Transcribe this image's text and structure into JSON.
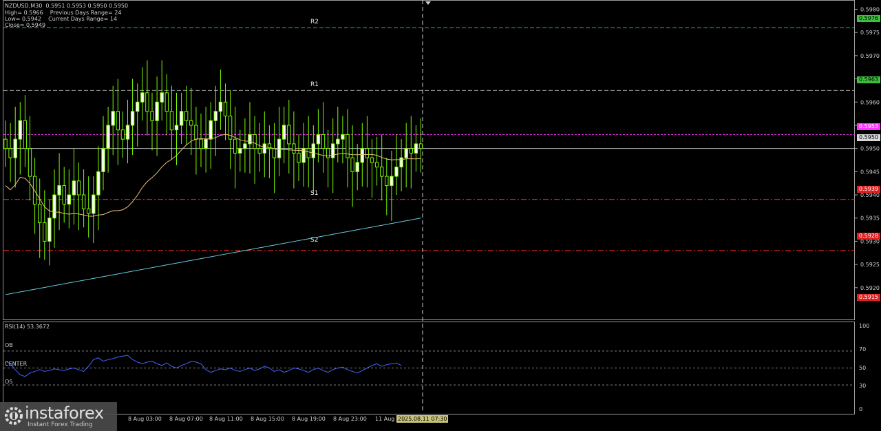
{
  "header": {
    "symbol_line": "NZDUSD,M30  0.5951 0.5953 0.5950 0.5950",
    "line2": "High= 0.5966    Previous Days Range= 24",
    "line3": "Low= 0.5942    Current Days Range= 14",
    "line4": "Close= 0.5949"
  },
  "levels": {
    "r2": "R2",
    "r1": "R1",
    "s1": "S1",
    "s2": "S2"
  },
  "price_tags": {
    "r2": "0.5976",
    "r1": "0.5963",
    "pivot": "0.5953",
    "current": "0.5950",
    "s1": "0.5939",
    "s2": "0.5928",
    "s3": "0.5915"
  },
  "colors": {
    "bull": "#7CFC00",
    "bull_fill": "#ffffff",
    "r_line": "#3fbf3f",
    "s_line": "#ff2a2a",
    "pivot_line": "#ff33ff",
    "ma_fast": "#e8c27a",
    "ma_slow": "#66ccdd",
    "rsi_line": "#4466ff"
  },
  "rsi": {
    "title": "RSI(14) 53.3672",
    "ob": "OB",
    "center": "CENTER",
    "os": "OS",
    "axis": [
      "100",
      "70",
      "50",
      "30",
      "0"
    ]
  },
  "x_labels": [
    "8 Aug 03:00",
    "8 Aug 07:00",
    "8 Aug 11:00",
    "8 Aug 15:00",
    "8 Aug 19:00",
    "8 Aug 23:00",
    "11 Aug",
    "2025.08.11 07:30"
  ],
  "logo": {
    "brand": "instaforex",
    "tagline": "Instant Forex Trading"
  },
  "chart_data": {
    "type": "candlestick",
    "title": "NZDUSD,M30",
    "y_ticks": [
      "0.5980",
      "0.5975",
      "0.5970",
      "0.5965",
      "0.5960",
      "0.5955",
      "0.5950",
      "0.5945",
      "0.5940",
      "0.5935",
      "0.5930",
      "0.5925",
      "0.5920"
    ],
    "ylim": [
      0.5913,
      0.5982
    ],
    "series": [
      {
        "name": "close",
        "values": [
          0.595,
          0.5948,
          0.5952,
          0.5956,
          0.595,
          0.5944,
          0.5938,
          0.5934,
          0.593,
          0.5935,
          0.594,
          0.5942,
          0.5938,
          0.594,
          0.5943,
          0.594,
          0.5937,
          0.5936,
          0.594,
          0.5945,
          0.595,
          0.5955,
          0.5958,
          0.5954,
          0.5952,
          0.5955,
          0.5958,
          0.596,
          0.5962,
          0.5958,
          0.5956,
          0.596,
          0.5962,
          0.5958,
          0.5954,
          0.5955,
          0.5958,
          0.5956,
          0.5955,
          0.5952,
          0.595,
          0.5952,
          0.5956,
          0.5958,
          0.596,
          0.5957,
          0.5952,
          0.5949,
          0.595,
          0.5951,
          0.5953,
          0.595,
          0.5949,
          0.5951,
          0.595,
          0.5948,
          0.5952,
          0.5955,
          0.5951,
          0.5949,
          0.5947,
          0.595,
          0.5948,
          0.5951,
          0.5953,
          0.595,
          0.5948,
          0.5951,
          0.5952,
          0.5953,
          0.5948,
          0.5945,
          0.5947,
          0.595,
          0.5948,
          0.5947,
          0.5946,
          0.5944,
          0.5942,
          0.5944,
          0.5946,
          0.5948,
          0.595,
          0.5949,
          0.5951,
          0.595
        ]
      }
    ],
    "rsi_values": [
      58,
      55,
      48,
      42,
      40,
      44,
      46,
      48,
      46,
      47,
      49,
      48,
      47,
      49,
      50,
      48,
      46,
      52,
      60,
      62,
      58,
      60,
      61,
      63,
      64,
      65,
      60,
      57,
      55,
      57,
      58,
      55,
      53,
      56,
      52,
      50,
      53,
      55,
      58,
      57,
      55,
      48,
      45,
      47,
      49,
      48,
      50,
      47,
      46,
      48,
      50,
      47,
      49,
      52,
      50,
      46,
      48,
      45,
      47,
      50,
      49,
      47,
      45,
      48,
      50,
      47,
      45,
      48,
      50,
      51,
      48,
      46,
      44,
      47,
      50,
      53,
      55,
      52,
      54,
      55,
      56,
      53
    ]
  }
}
